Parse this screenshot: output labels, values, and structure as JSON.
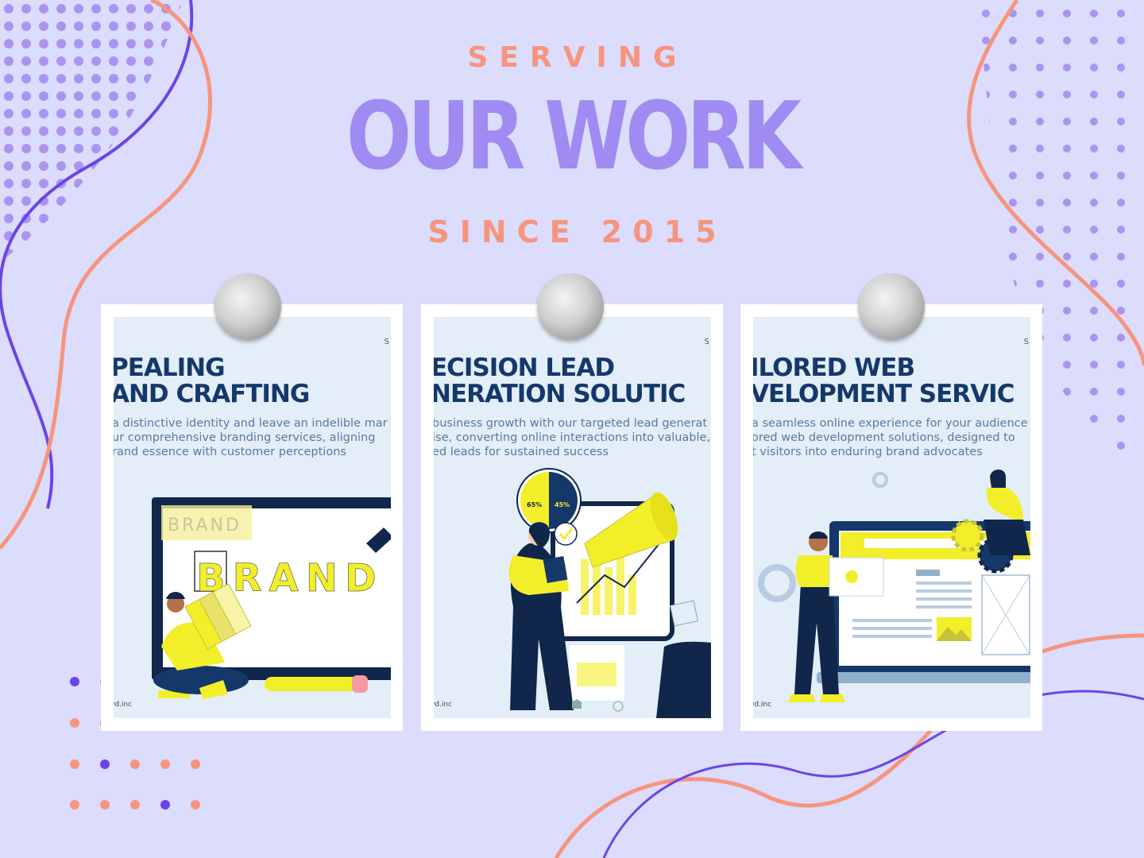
{
  "header": {
    "kicker": "SERVING",
    "title": "OUR WORK",
    "since": "SINCE 2015"
  },
  "colors": {
    "background": "#dcdcfc",
    "coral": "#f6957e",
    "violet": "#9f8bf1",
    "deep_violet": "#6a45e6",
    "navy": "#15386b",
    "yellow": "#f2ee2a"
  },
  "cards": [
    {
      "heading": "PEALING\nAND CRAFTING",
      "body": "a distinctive identity and leave an indelible mar\nur comprehensive branding services, aligning\nrand essence with customer perceptions",
      "corner": "S",
      "footer": "wd.inc",
      "illustration": "branding-illustration",
      "screen_text": "BRAND",
      "sticker_text": "BRAND"
    },
    {
      "heading": "ECISION LEAD\nNERATION SOLUTIC",
      "body": "business growth with our targeted lead generat\nise, converting online interactions into valuable,\ned leads for sustained success",
      "corner": "S",
      "footer": "wd.inc",
      "illustration": "lead-generation-illustration",
      "stat_left": "65%",
      "stat_right": "45%"
    },
    {
      "heading": "ILORED WEB\nVELOPMENT SERVIC",
      "body": "a seamless online experience for your audience\nored web development solutions, designed to\nt visitors into enduring brand advocates",
      "corner": "S",
      "footer": "wd.inc",
      "illustration": "web-development-illustration"
    }
  ]
}
